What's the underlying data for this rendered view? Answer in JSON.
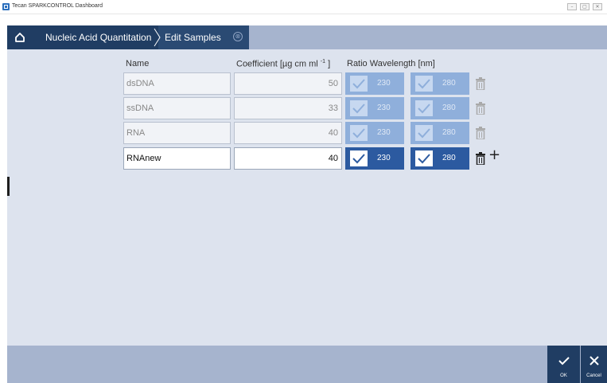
{
  "window": {
    "title": "Tecan SPARKCONTROL Dashboard",
    "controls": [
      "–",
      "▢",
      "✕"
    ]
  },
  "breadcrumb": {
    "home_icon": "home-icon",
    "items": [
      "Nucleic Acid Quantitation",
      "Edit Samples"
    ],
    "close_icon": "⊗"
  },
  "table": {
    "headers": {
      "name": "Name",
      "coefficient_prefix": "Coefficient [µg cm ml ",
      "coefficient_sup": "-1",
      "coefficient_suffix": " ]",
      "ratio": "Ratio Wavelength [nm]"
    },
    "rows": [
      {
        "name": "dsDNA",
        "coefficient": "50",
        "wl1": "230",
        "wl2": "280",
        "editable": false
      },
      {
        "name": "ssDNA",
        "coefficient": "33",
        "wl1": "230",
        "wl2": "280",
        "editable": false
      },
      {
        "name": "RNA",
        "coefficient": "40",
        "wl1": "230",
        "wl2": "280",
        "editable": false
      },
      {
        "name": "RNAnew",
        "coefficient": "40",
        "wl1": "230",
        "wl2": "280",
        "editable": true
      }
    ],
    "add_label": "+"
  },
  "actions": {
    "ok_label": "OK",
    "cancel_label": "Cancel"
  },
  "colors": {
    "nav_dark": "#203d63",
    "bar_light": "#a6b4ce",
    "content_bg": "#dde3ee",
    "button_active": "#2c5aa0",
    "button_disabled": "#8fafdb"
  }
}
